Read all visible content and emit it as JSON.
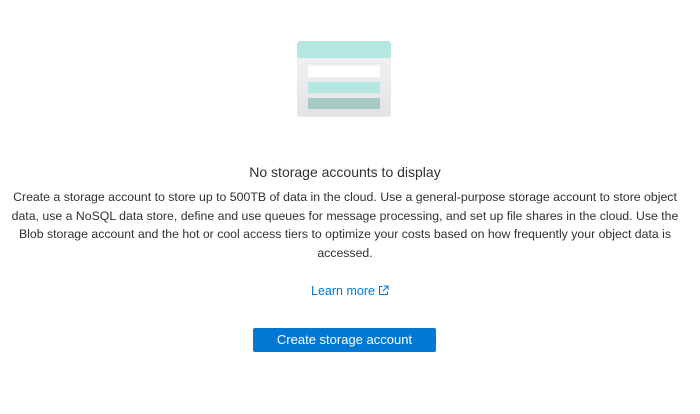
{
  "empty_state": {
    "illustration_icon": "storage-account-empty-icon",
    "title": "No storage accounts to display",
    "description": "Create a storage account to store up to 500TB of data in the cloud. Use a general-purpose storage account to store object data, use a NoSQL data store, define and use queues for message processing, and set up file shares in the cloud. Use the Blob storage account and the hot or cool access tiers to optimize your costs based on how frequently your object data is accessed.",
    "learn_more_label": "Learn more",
    "learn_more_icon": "external-link-icon",
    "create_button_label": "Create storage account"
  },
  "colors": {
    "accent": "#0078d4",
    "illustration_top": "#b3e7e0",
    "illustration_stripe": "#b3e7e0",
    "illustration_stripe_dark": "#a7c9c4",
    "illustration_body": "#ececec"
  }
}
